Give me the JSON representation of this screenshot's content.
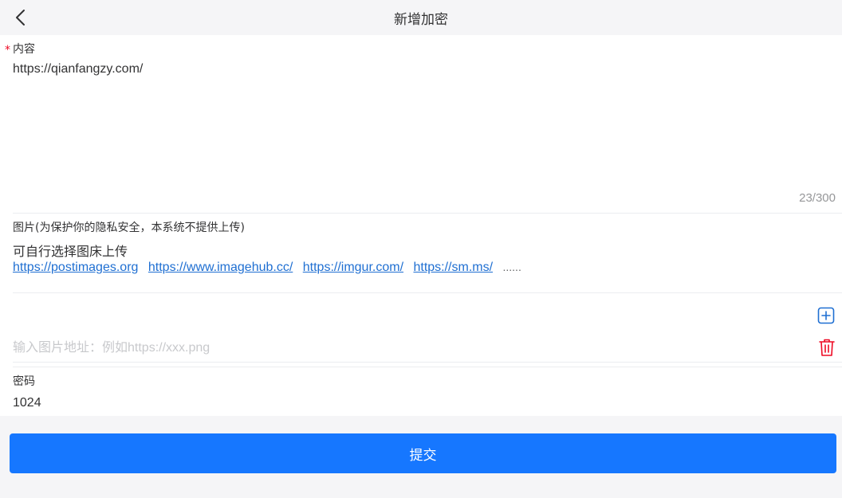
{
  "navbar": {
    "title": "新增加密"
  },
  "form": {
    "content": {
      "required_mark": "*",
      "label": "内容",
      "value": "https://qianfangzy.com/",
      "word_limit": "23/300"
    },
    "image": {
      "label": "图片(为保护你的隐私安全，本系统不提供上传)",
      "hint": "可自行选择图床上传",
      "links": [
        "https://postimages.org",
        "https://www.imagehub.cc/",
        "https://imgur.com/",
        "https://sm.ms/"
      ],
      "more": "......",
      "input_placeholder": "输入图片地址：例如https://xxx.png"
    },
    "password": {
      "label": "密码",
      "value": "1024"
    }
  },
  "submit": {
    "label": "提交"
  },
  "colors": {
    "accent": "#1677ff",
    "link": "#1f6fd2",
    "danger": "#ee0a24"
  }
}
